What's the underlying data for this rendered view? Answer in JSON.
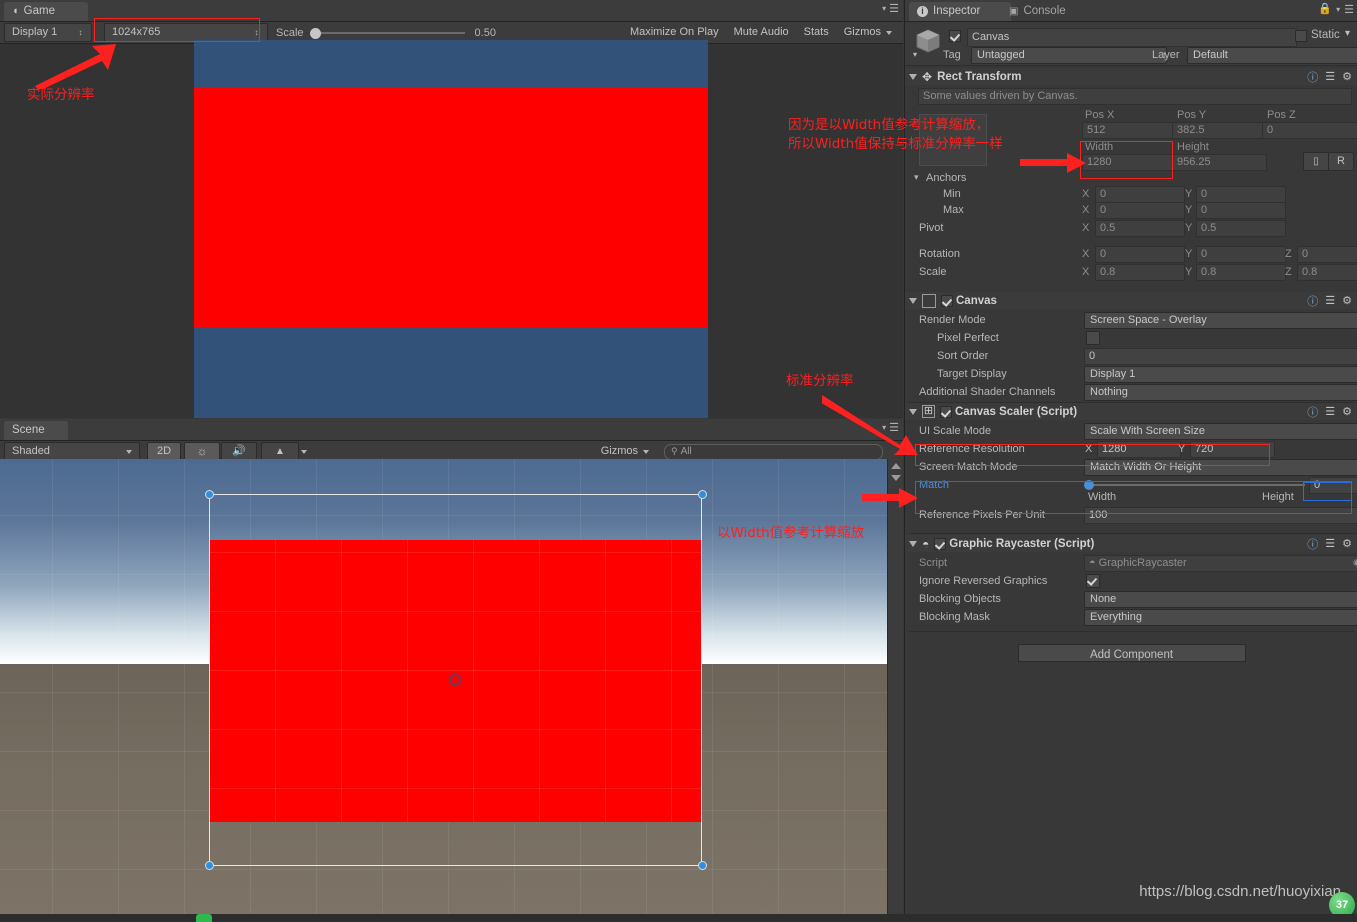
{
  "game_view": {
    "tab_label": "Game",
    "display_label": "Display 1",
    "resolution_value": "1024x765",
    "scale_label": "Scale",
    "scale_value": "0.50",
    "maximize_label": "Maximize On Play",
    "mute_label": "Mute Audio",
    "stats_label": "Stats",
    "gizmos_label": "Gizmos",
    "blue_color": "#325279",
    "red_color": "#ff0000"
  },
  "scene_view": {
    "tab_label": "Scene",
    "shading_value": "Shaded",
    "two_d_label": "2D",
    "light_icon": "sun-icon",
    "audio_icon": "speaker-icon",
    "fx_icon": "image-effects-icon",
    "gizmos_label": "Gizmos",
    "search_placeholder": "All",
    "search_value": "All"
  },
  "inspector": {
    "tabs": [
      {
        "label": "Inspector",
        "icon": "info-icon",
        "active": true
      },
      {
        "label": "Console",
        "icon": "console-icon",
        "active": false
      }
    ],
    "lock_icon": "lock-icon",
    "menu_icon": "hamburger-menu-icon",
    "object_name": "Canvas",
    "object_enabled": true,
    "static_label": "Static",
    "static_checked": false,
    "tag_label": "Tag",
    "tag_value": "Untagged",
    "layer_label": "Layer",
    "layer_value": "Default",
    "components": [
      {
        "title": "Rect Transform",
        "icon": "rect-transform-icon",
        "help_box": "Some values driven by Canvas.",
        "pos_labels": [
          "Pos X",
          "Pos Y",
          "Pos Z"
        ],
        "pos_values": [
          "512",
          "382.5",
          "0"
        ],
        "size_labels": [
          "Width",
          "Height"
        ],
        "size_values": [
          "1280",
          "956.25"
        ],
        "blueprint_label": "",
        "raw_label": "R",
        "anchors_label": "Anchors",
        "min_label": "Min",
        "min_x": "0",
        "min_y": "0",
        "max_label": "Max",
        "max_x": "0",
        "max_y": "0",
        "pivot_label": "Pivot",
        "pivot_x": "0.5",
        "pivot_y": "0.5",
        "rotation_label": "Rotation",
        "rot_x": "0",
        "rot_y": "0",
        "rot_z": "0",
        "scale_label": "Scale",
        "scale_x": "0.8",
        "scale_y": "0.8",
        "scale_z": "0.8",
        "axis_x": "X",
        "axis_y": "Y",
        "axis_z": "Z"
      },
      {
        "title": "Canvas",
        "icon": "canvas-icon",
        "enabled": true,
        "fields": [
          {
            "label": "Render Mode",
            "value": "Screen Space - Overlay",
            "kind": "popup"
          },
          {
            "label": "Pixel Perfect",
            "value": "",
            "kind": "checkbox",
            "checked": false
          },
          {
            "label": "Sort Order",
            "value": "0",
            "kind": "text"
          },
          {
            "label": "Target Display",
            "value": "Display 1",
            "kind": "popup"
          },
          {
            "label": "Additional Shader Channels",
            "value": "Nothing",
            "kind": "popup"
          }
        ]
      },
      {
        "title": "Canvas Scaler (Script)",
        "icon": "canvas-scaler-icon",
        "enabled": true,
        "ui_scale_mode_label": "UI Scale Mode",
        "ui_scale_mode_value": "Scale With Screen Size",
        "reference_resolution_label": "Reference Resolution",
        "reference_resolution_x_label": "X",
        "reference_resolution_x": "1280",
        "reference_resolution_y_label": "Y",
        "reference_resolution_y": "720",
        "screen_match_mode_label": "Screen Match Mode",
        "screen_match_mode_value": "Match Width Or Height",
        "match_label": "Match",
        "match_width_label": "Width",
        "match_height_label": "Height",
        "match_value": "0",
        "ref_ppu_label": "Reference Pixels Per Unit",
        "ref_ppu_value": "100"
      },
      {
        "title": "Graphic Raycaster (Script)",
        "icon": "graphic-raycaster-icon",
        "enabled": true,
        "fields": [
          {
            "label": "Script",
            "value": "GraphicRaycaster",
            "kind": "object"
          },
          {
            "label": "Ignore Reversed Graphics",
            "value": "",
            "kind": "checkbox",
            "checked": true
          },
          {
            "label": "Blocking Objects",
            "value": "None",
            "kind": "popup"
          },
          {
            "label": "Blocking Mask",
            "value": "Everything",
            "kind": "popup"
          }
        ]
      }
    ],
    "add_component_label": "Add Component"
  },
  "annotations": [
    {
      "id": "actual-resolution",
      "text": "实际分辨率"
    },
    {
      "id": "width-reference",
      "text": "因为是以Width值参考计算缩放，\n所以Width值保持与标准分辨率一样"
    },
    {
      "id": "standard-resolution",
      "text": "标准分辨率"
    },
    {
      "id": "scale-by-width",
      "text": "以Width值参考计算缩放"
    }
  ],
  "watermark": {
    "url": "https://blog.csdn.net/huoyixian",
    "badge": "37"
  },
  "colors": {
    "highlight_red": "#ff2020",
    "highlight_blue": "#2a6fe0",
    "accent_blue": "#4b90d4"
  }
}
